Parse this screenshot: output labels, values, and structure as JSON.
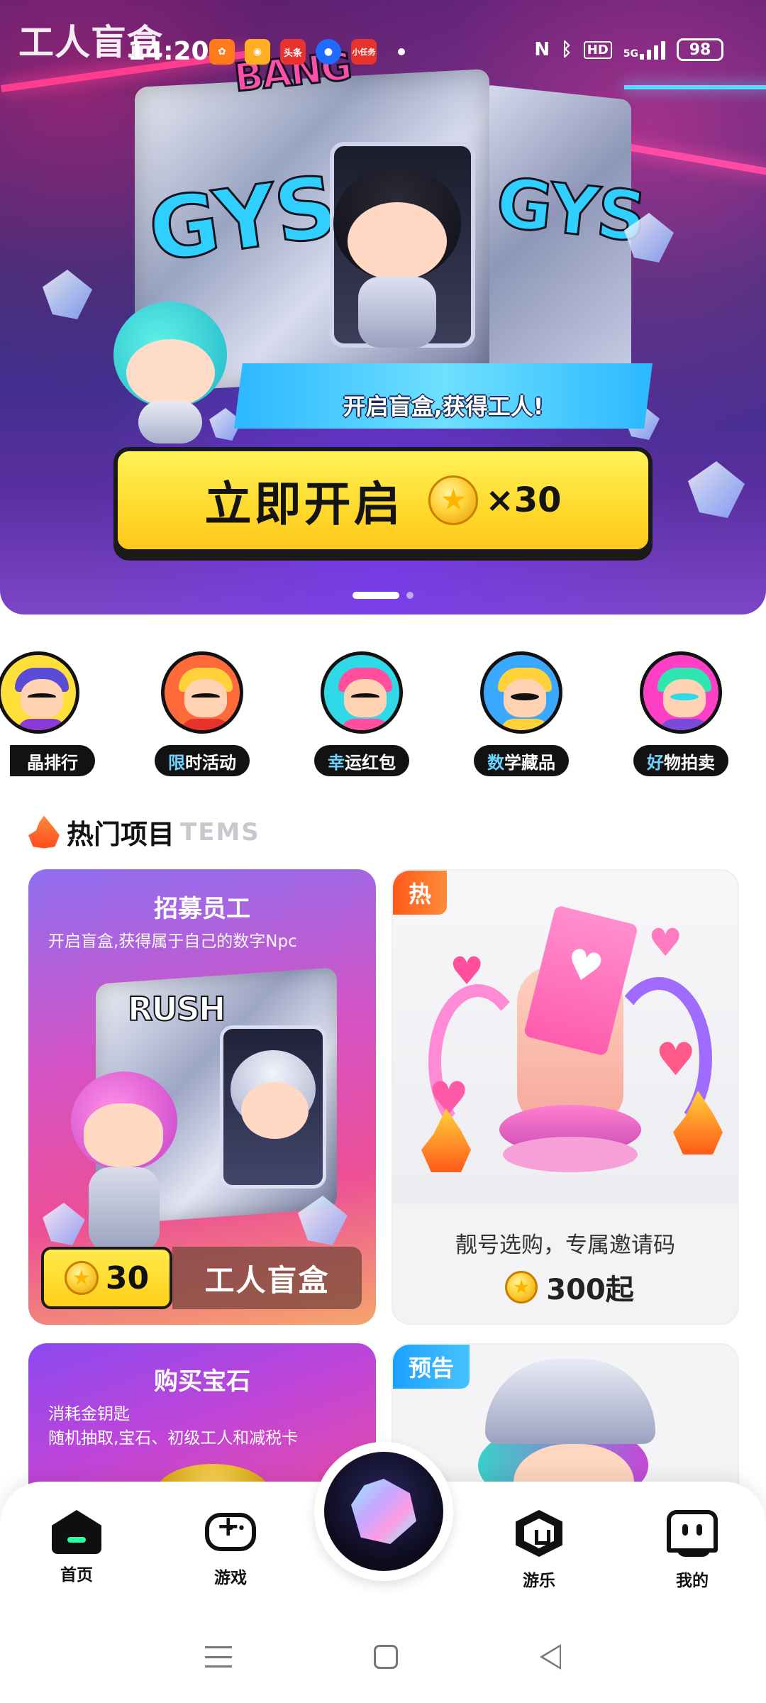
{
  "app_label": "工人盲盒",
  "status_bar": {
    "time": "14:20",
    "notification_icons": [
      "app-store-icon",
      "weibo-icon",
      "toutiao-icon",
      "browser-icon",
      "task-icon"
    ],
    "toutiao_text": "头条",
    "task_text": "小任务",
    "nfc": "N",
    "network_hd": "HD",
    "network_5g": "5G",
    "battery": "98"
  },
  "hero": {
    "tagline": "开启盲盒,获得工人!",
    "open_button_label": "立即开启",
    "open_button_cost": "×30",
    "carousel_pages": 2,
    "carousel_active": 0
  },
  "categories": [
    {
      "highlight": "",
      "label": "晶排行"
    },
    {
      "highlight": "限",
      "label": "时活动"
    },
    {
      "highlight": "幸",
      "label": "运红包"
    },
    {
      "highlight": "数",
      "label": "学藏品"
    },
    {
      "highlight": "好",
      "label": "物拍卖"
    }
  ],
  "section": {
    "title": "热门项目",
    "subtitle": "TEMS"
  },
  "cards": {
    "recruit": {
      "title": "招募员工",
      "subtitle": "开启盲盒,获得属于自己的数字Npc",
      "price": "30",
      "name": "工人盲盒"
    },
    "ticket": {
      "tag": "热",
      "desc": "靓号选购，专属邀请码",
      "price": "300起"
    },
    "gem": {
      "title": "购买宝石",
      "line1": "消耗金钥匙",
      "line2": "随机抽取,宝石、初级工人和减税卡"
    },
    "preview": {
      "tag": "预告"
    }
  },
  "bottom_nav": {
    "items": [
      {
        "label": "首页",
        "icon": "home-icon"
      },
      {
        "label": "游戏",
        "icon": "gamepad-icon"
      },
      {
        "label": "",
        "icon": "gem-icon"
      },
      {
        "label": "游乐",
        "icon": "cube-icon"
      },
      {
        "label": "我的",
        "icon": "profile-icon"
      }
    ]
  },
  "colors": {
    "accent_yellow": "#ffd92b",
    "tag_hot": "#ff5a1a",
    "tag_preview": "#1aa0ff",
    "pill_highlight": "#6fd3ff"
  }
}
